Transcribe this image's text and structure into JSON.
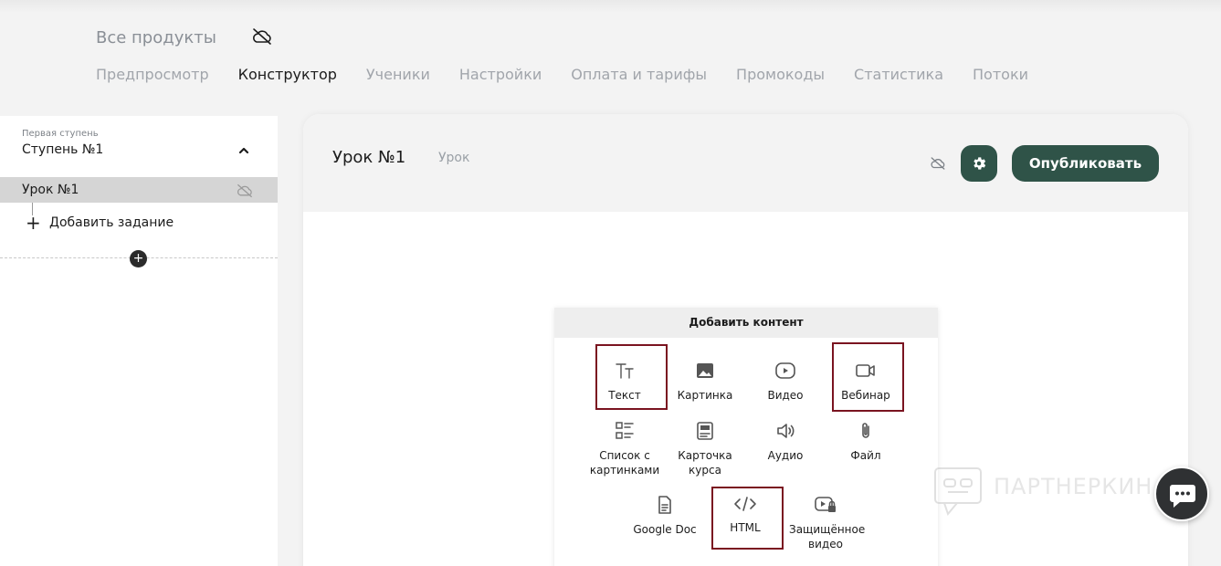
{
  "breadcrumb": {
    "title": "Все продукты"
  },
  "tabs": [
    {
      "label": "Предпросмотр",
      "active": false
    },
    {
      "label": "Конструктор",
      "active": true
    },
    {
      "label": "Ученики",
      "active": false
    },
    {
      "label": "Настройки",
      "active": false
    },
    {
      "label": "Оплата и тарифы",
      "active": false
    },
    {
      "label": "Промокоды",
      "active": false
    },
    {
      "label": "Статистика",
      "active": false
    },
    {
      "label": "Потоки",
      "active": false
    }
  ],
  "sidebar": {
    "step_caption": "Первая ступень",
    "step_title": "Ступень №1",
    "lesson_label": "Урок №1",
    "add_task_label": "Добавить задание",
    "add_step_glyph": "+"
  },
  "lesson": {
    "title": "Урок №1",
    "type": "Урок",
    "publish_label": "Опубликовать"
  },
  "popup": {
    "title": "Добавить контент",
    "items": [
      {
        "label": "Текст",
        "icon": "text-icon",
        "highlighted": true
      },
      {
        "label": "Картинка",
        "icon": "image-icon",
        "highlighted": false
      },
      {
        "label": "Видео",
        "icon": "video-icon",
        "highlighted": false
      },
      {
        "label": "Вебинар",
        "icon": "webinar-icon",
        "highlighted": true
      },
      {
        "label": "Список с картинками",
        "icon": "image-list-icon",
        "highlighted": false
      },
      {
        "label": "Карточка курса",
        "icon": "course-card-icon",
        "highlighted": false
      },
      {
        "label": "Аудио",
        "icon": "audio-icon",
        "highlighted": false
      },
      {
        "label": "Файл",
        "icon": "paperclip-icon",
        "highlighted": false
      },
      {
        "label": "Google Doc",
        "icon": "document-icon",
        "highlighted": false
      },
      {
        "label": "HTML",
        "icon": "code-icon",
        "highlighted": true
      },
      {
        "label": "Защищённое видео",
        "icon": "protected-video-icon",
        "highlighted": false
      }
    ]
  },
  "watermark": {
    "text": "ПАРТНЕРКИН"
  },
  "colors": {
    "accent": "#2f5348",
    "highlight": "#7a1420",
    "sidebar_selected": "#d5d5d5"
  }
}
